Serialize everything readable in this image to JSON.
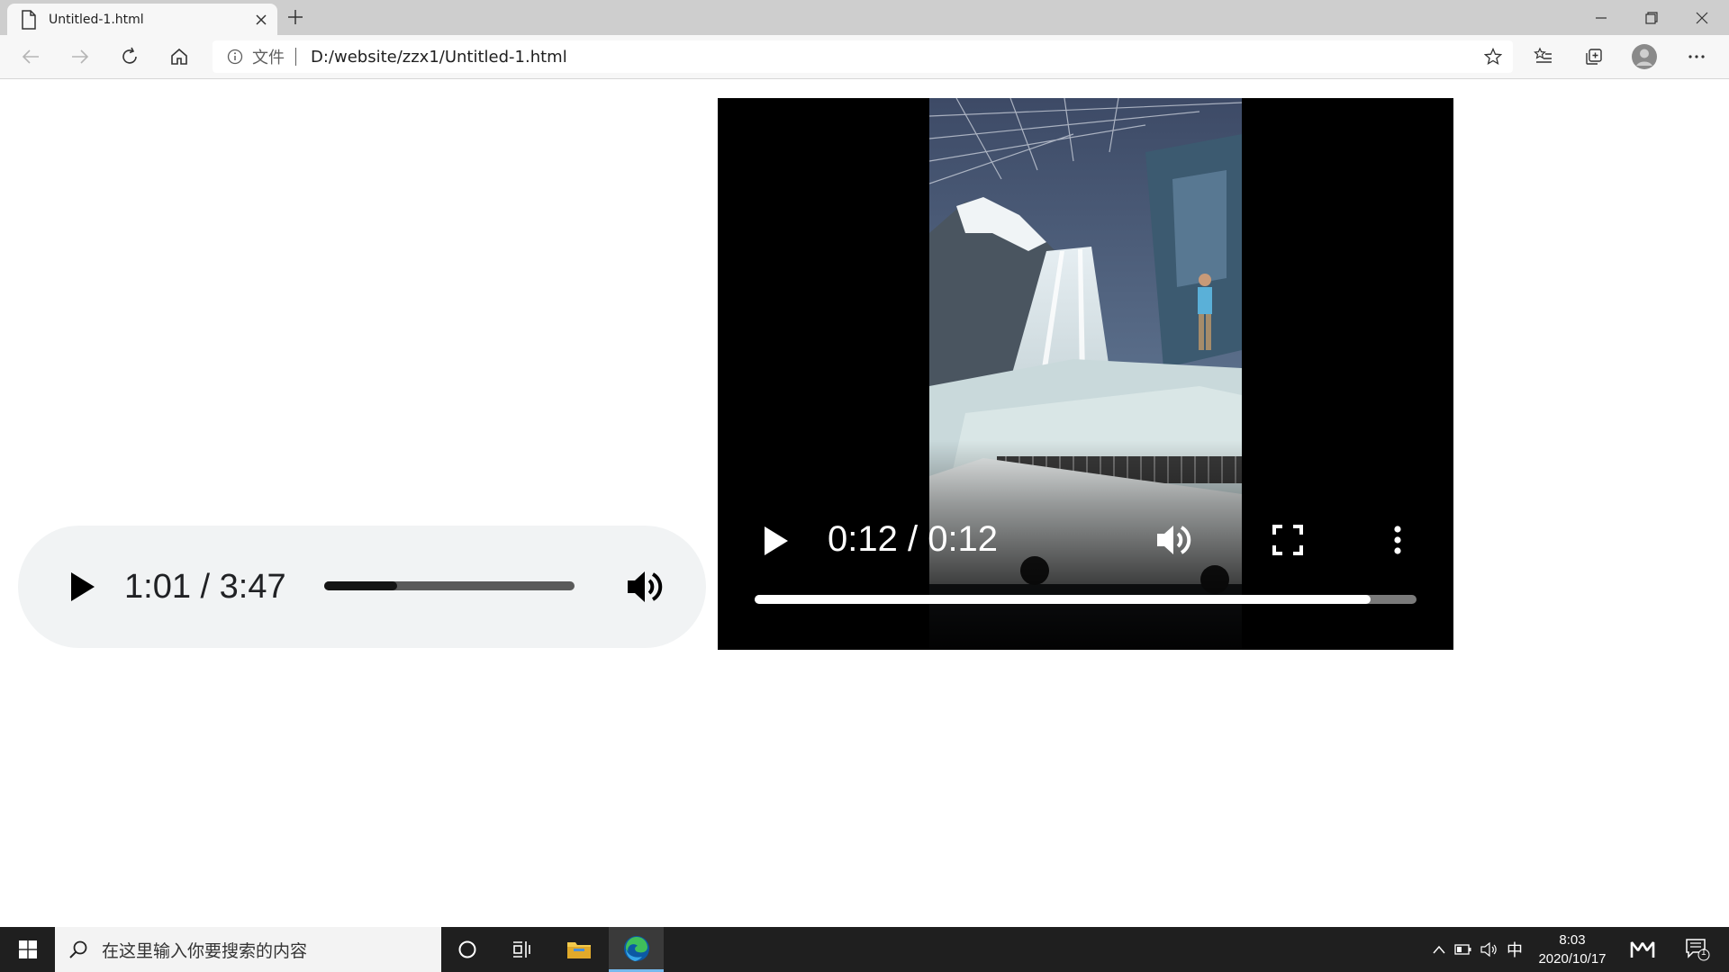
{
  "browser": {
    "tab_title": "Untitled-1.html",
    "scheme_label": "文件",
    "url": "D:/website/zzx1/Untitled-1.html"
  },
  "audio_player": {
    "time_display": "1:01 / 3:47",
    "progress_fraction": 0.29
  },
  "video_player": {
    "time_display": "0:12 / 0:12",
    "progress_fraction": 0.93
  },
  "taskbar": {
    "search_placeholder": "在这里输入你要搜索的内容",
    "ime_indicator": "中",
    "clock_time": "8:03",
    "clock_date": "2020/10/17",
    "notification_count": "1"
  },
  "colors": {
    "edge_blue": "#0c59a4",
    "edge_green": "#3fbf5b",
    "folder_yellow": "#f2c94c"
  }
}
